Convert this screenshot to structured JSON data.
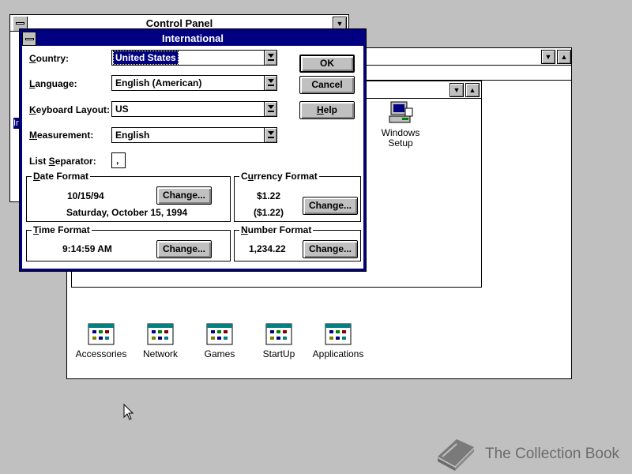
{
  "control_panel": {
    "title": "Control Panel"
  },
  "program_manager": {
    "partial_label": "Ir"
  },
  "program_group": {
    "icons": [
      {
        "label": "Accessories"
      },
      {
        "label": "Network"
      },
      {
        "label": "Games"
      },
      {
        "label": "StartUp"
      },
      {
        "label": "Applications"
      }
    ]
  },
  "main_group": {
    "windows_setup": {
      "line1": "Windows",
      "line2": "Setup"
    }
  },
  "dialog": {
    "title": "International",
    "fields": {
      "country": {
        "label_pre": "",
        "label_key": "C",
        "label_post": "ountry:",
        "value": "United States"
      },
      "language": {
        "label_pre": "",
        "label_key": "L",
        "label_post": "anguage:",
        "value": "English (American)"
      },
      "keyboard": {
        "label_pre": "",
        "label_key": "K",
        "label_post": "eyboard Layout:",
        "value": "US"
      },
      "measurement": {
        "label_pre": "",
        "label_key": "M",
        "label_post": "easurement:",
        "value": "English"
      },
      "separator": {
        "label_pre": "List ",
        "label_key": "S",
        "label_post": "eparator:",
        "value": ","
      }
    },
    "buttons": {
      "ok": "OK",
      "cancel": "Cancel",
      "help_key": "H",
      "help_rest": "elp"
    },
    "date_format": {
      "title_key": "D",
      "title_rest": "ate Format",
      "short": "10/15/94",
      "long": "Saturday, October 15, 1994",
      "change": "Change..."
    },
    "currency_format": {
      "title_pre": "C",
      "title_key": "u",
      "title_rest": "rrency Format",
      "positive": "$1.22",
      "negative": "($1.22)",
      "change": "Change..."
    },
    "time_format": {
      "title_key": "T",
      "title_rest": "ime Format",
      "value": "9:14:59 AM",
      "change": "Change..."
    },
    "number_format": {
      "title_key": "N",
      "title_rest": "umber Format",
      "value": "1,234.22",
      "change": "Change..."
    }
  },
  "watermark": {
    "text": "The Collection Book"
  },
  "colors": {
    "active_title": "#000080",
    "desktop": "#c0c0c0"
  }
}
